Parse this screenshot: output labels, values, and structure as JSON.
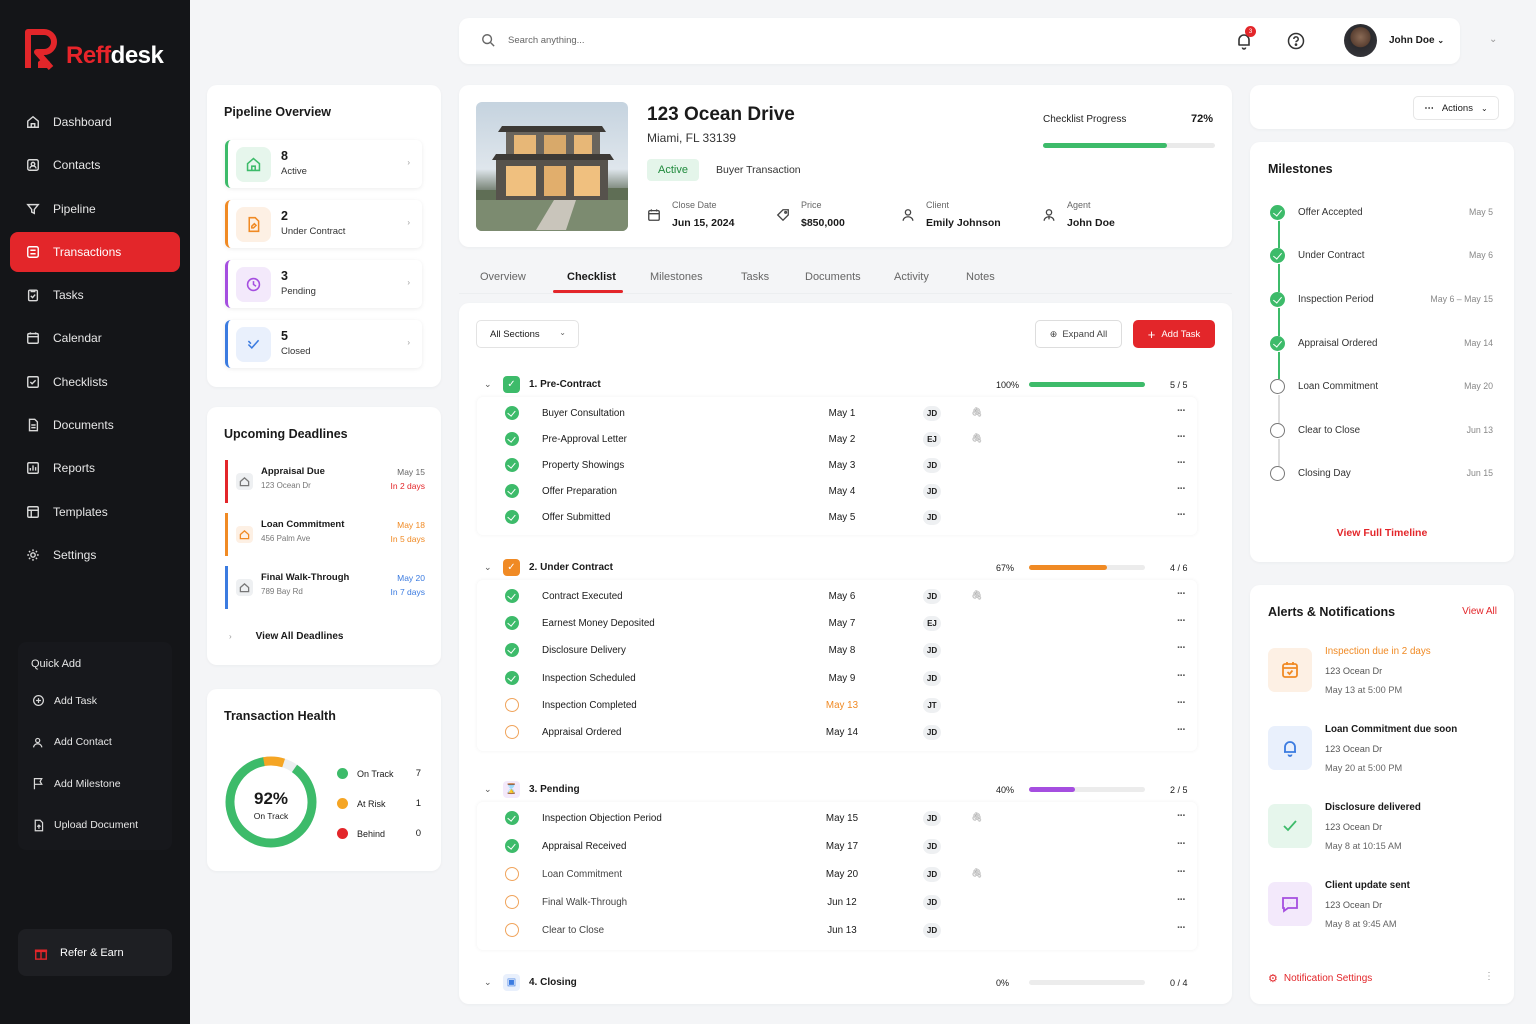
{
  "brand": {
    "name_part1": "Reff",
    "name_part2": "desk",
    "accent": "#e3262a"
  },
  "nav": [
    {
      "label": "Dashboard",
      "icon": "home-icon"
    },
    {
      "label": "Contacts",
      "icon": "contacts-icon"
    },
    {
      "label": "Pipeline",
      "icon": "filter-icon"
    },
    {
      "label": "Transactions",
      "icon": "transactions-icon",
      "active": true
    },
    {
      "label": "Tasks",
      "icon": "tasks-icon"
    },
    {
      "label": "Calendar",
      "icon": "calendar-icon"
    },
    {
      "label": "Checklists",
      "icon": "checklist-icon"
    },
    {
      "label": "Documents",
      "icon": "document-icon"
    },
    {
      "label": "Reports",
      "icon": "reports-icon"
    },
    {
      "label": "Templates",
      "icon": "templates-icon"
    },
    {
      "label": "Settings",
      "icon": "gear-icon"
    }
  ],
  "quick_add": {
    "title": "Quick Add",
    "items": [
      "Add Task",
      "Add Contact",
      "Add Milestone",
      "Upload Document"
    ]
  },
  "refer": "Refer & Earn",
  "topbar": {
    "search_placeholder": "Search anything...",
    "notif_count": "3",
    "user_name": "John Doe"
  },
  "pipeline": {
    "title": "Pipeline Overview",
    "items": [
      {
        "count": "8",
        "label": "Active",
        "color": "#3dbb6a"
      },
      {
        "count": "2",
        "label": "Under Contract",
        "color": "#f08a24"
      },
      {
        "count": "3",
        "label": "Pending",
        "color": "#a54ee0"
      },
      {
        "count": "5",
        "label": "Closed",
        "color": "#3b7be0"
      }
    ]
  },
  "deadlines": {
    "title": "Upcoming Deadlines",
    "items": [
      {
        "title": "Appraisal Due",
        "address": "123 Ocean Dr",
        "date": "May 15",
        "due": "In 2 days",
        "color": "#e3262a"
      },
      {
        "title": "Loan Commitment",
        "address": "456 Palm Ave",
        "date": "May 18",
        "due": "In 5 days",
        "color": "#f08a24"
      },
      {
        "title": "Final Walk-Through",
        "address": "789 Bay Rd",
        "date": "May 20",
        "due": "In 7 days",
        "color": "#3b7be0"
      }
    ],
    "view_all": "View All Deadlines"
  },
  "health": {
    "title": "Transaction Health",
    "percent": "92%",
    "caption": "On Track",
    "legend": [
      {
        "label": "On Track",
        "value": "7",
        "color": "#3dbb6a"
      },
      {
        "label": "At Risk",
        "value": "1",
        "color": "#f5a524"
      },
      {
        "label": "Behind",
        "value": "0",
        "color": "#e3262a"
      }
    ]
  },
  "property": {
    "title": "123 Ocean Drive",
    "location": "Miami, FL 33139",
    "status": "Active",
    "type": "Buyer Transaction",
    "meta": [
      {
        "label": "Close Date",
        "value": "Jun 15, 2024",
        "icon": "calendar-icon"
      },
      {
        "label": "Price",
        "value": "$850,000",
        "icon": "tag-icon"
      },
      {
        "label": "Client",
        "value": "Emily Johnson",
        "icon": "user-icon"
      },
      {
        "label": "Agent",
        "value": "John Doe",
        "icon": "agent-icon"
      }
    ],
    "progress_label": "Checklist Progress",
    "progress_value": "72%",
    "progress": 0.72
  },
  "tabs": [
    "Overview",
    "Checklist",
    "Milestones",
    "Tasks",
    "Documents",
    "Activity",
    "Notes"
  ],
  "checklist": {
    "filter": "All Sections",
    "expand_all": "Expand All",
    "add_task": "Add Task",
    "sections": [
      {
        "title": "1. Pre-Contract",
        "pct": "100%",
        "progress": 1.0,
        "count": "5 / 5",
        "color": "#3dbb6a",
        "rows": [
          {
            "name": "Buyer Consultation",
            "date": "May 1",
            "who": "JD",
            "done": true,
            "clip": true
          },
          {
            "name": "Pre-Approval Letter",
            "date": "May 2",
            "who": "EJ",
            "done": true,
            "clip": true
          },
          {
            "name": "Property Showings",
            "date": "May 3",
            "who": "JD",
            "done": true
          },
          {
            "name": "Offer Preparation",
            "date": "May 4",
            "who": "JD",
            "done": true
          },
          {
            "name": "Offer Submitted",
            "date": "May 5",
            "who": "JD",
            "done": true
          }
        ]
      },
      {
        "title": "2. Under Contract",
        "pct": "67%",
        "progress": 0.67,
        "count": "4 / 6",
        "color": "#f08a24",
        "rows": [
          {
            "name": "Contract Executed",
            "date": "May 6",
            "who": "JD",
            "done": true,
            "clip": true
          },
          {
            "name": "Earnest Money Deposited",
            "date": "May 7",
            "who": "EJ",
            "done": true
          },
          {
            "name": "Disclosure Delivery",
            "date": "May 8",
            "who": "JD",
            "done": true
          },
          {
            "name": "Inspection Scheduled",
            "date": "May 9",
            "who": "JD",
            "done": true
          },
          {
            "name": "Inspection Completed",
            "date": "May 13",
            "who": "JT",
            "done": false,
            "due": true
          },
          {
            "name": "Appraisal Ordered",
            "date": "May 14",
            "who": "JD",
            "done": false
          }
        ]
      },
      {
        "title": "3. Pending",
        "pct": "40%",
        "progress": 0.4,
        "count": "2 / 5",
        "color": "#a54ee0",
        "rows": [
          {
            "name": "Inspection Objection Period",
            "date": "May 15",
            "who": "JD",
            "done": true,
            "clip": true
          },
          {
            "name": "Appraisal Received",
            "date": "May 17",
            "who": "JD",
            "done": true
          },
          {
            "name": "Loan Commitment",
            "date": "May 20",
            "who": "JD",
            "done": false,
            "clip": true
          },
          {
            "name": "Final Walk-Through",
            "date": "Jun 12",
            "who": "JD",
            "done": false
          },
          {
            "name": "Clear to Close",
            "date": "Jun 13",
            "who": "JD",
            "done": false
          }
        ]
      },
      {
        "title": "4. Closing",
        "pct": "0%",
        "progress": 0,
        "count": "0 / 4",
        "color": "#3b7be0",
        "rows": []
      }
    ]
  },
  "actions": "Actions",
  "milestones": {
    "title": "Milestones",
    "items": [
      {
        "label": "Offer Accepted",
        "date": "May 5",
        "done": true
      },
      {
        "label": "Under Contract",
        "date": "May 6",
        "done": true
      },
      {
        "label": "Inspection Period",
        "date": "May 6 – May 15",
        "done": true
      },
      {
        "label": "Appraisal Ordered",
        "date": "May 14",
        "done": true
      },
      {
        "label": "Loan Commitment",
        "date": "May 20",
        "done": false
      },
      {
        "label": "Clear to Close",
        "date": "Jun 13",
        "done": false
      },
      {
        "label": "Closing Day",
        "date": "Jun 15",
        "done": false
      }
    ],
    "view_full": "View Full Timeline"
  },
  "alerts": {
    "title": "Alerts & Notifications",
    "view_all": "View All",
    "items": [
      {
        "title": "Inspection due in 2 days",
        "address": "123 Ocean Dr",
        "time": "May 13 at 5:00 PM",
        "icon": "calendar-icon",
        "color": "#f08a24",
        "bg": "#fdf0e4",
        "highlight": true
      },
      {
        "title": "Loan Commitment due soon",
        "address": "123 Ocean Dr",
        "time": "May 20 at 5:00 PM",
        "icon": "bell-icon",
        "color": "#3b7be0",
        "bg": "#e9f0fc"
      },
      {
        "title": "Disclosure delivered",
        "address": "123 Ocean Dr",
        "time": "May 8 at 10:15 AM",
        "icon": "check-icon",
        "color": "#3dbb6a",
        "bg": "#e6f6ec"
      },
      {
        "title": "Client update sent",
        "address": "123 Ocean Dr",
        "time": "May 8 at 9:45 AM",
        "icon": "message-icon",
        "color": "#a54ee0",
        "bg": "#f3e9fb"
      }
    ],
    "settings": "Notification Settings"
  }
}
